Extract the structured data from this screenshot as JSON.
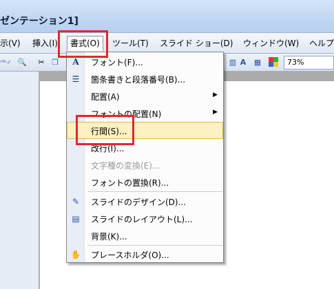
{
  "title": "ゼンテーション1]",
  "menubar": {
    "items": [
      "示(V)",
      "挿入(I)",
      "書式(O)",
      "ツール(T)",
      "スライド ショー(D)",
      "ウィンドウ(W)",
      "ヘルプ"
    ]
  },
  "toolbar": {
    "zoom": "73%"
  },
  "format_menu": {
    "items": [
      "フォント(F)...",
      "箇条書きと段落番号(B)...",
      "配置(A)",
      "フォントの配置(N)",
      "行間(S)...",
      "改行(I)...",
      "文字種の変換(E)...",
      "フォントの置換(R)...",
      "スライドのデザイン(D)...",
      "スライドのレイアウト(L)...",
      "背景(K)...",
      "プレースホルダ(O)..."
    ]
  }
}
